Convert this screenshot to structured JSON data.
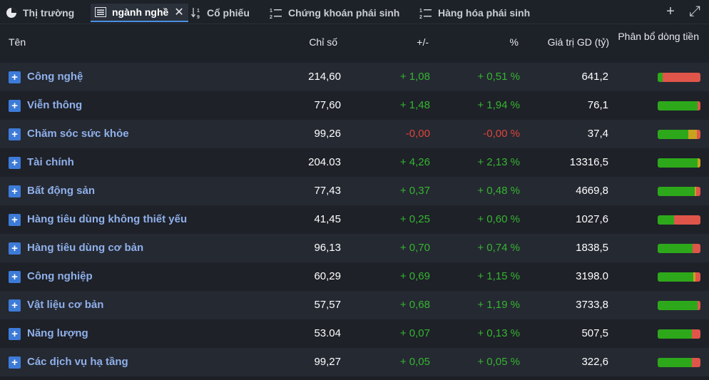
{
  "tabs": [
    {
      "label": "Thị trường",
      "icon": "pie-chart-icon"
    },
    {
      "label": "ngành nghề",
      "icon": "list-icon"
    },
    {
      "label": "Cổ phiếu",
      "icon": "sort-icon"
    },
    {
      "label": "Chứng khoán phái sinh",
      "icon": "numbered-list-icon"
    },
    {
      "label": "Hàng hóa phái sinh",
      "icon": "numbered-list-icon"
    }
  ],
  "actions": {
    "add": "+",
    "expand": "⤢"
  },
  "columns": {
    "name": "Tên",
    "index": "Chỉ số",
    "change": "+/-",
    "percent": "%",
    "value": "Giá trị GD (tỷ)",
    "flow": "Phân bổ dòng tiền"
  },
  "rows": [
    {
      "name": "Công nghệ",
      "index": "214,60",
      "change": "+ 1,08",
      "percent": "+ 0,51 %",
      "value": "641,2",
      "flow": [
        0.12,
        0.0,
        0.88
      ]
    },
    {
      "name": "Viễn thông",
      "index": "77,60",
      "change": "+ 1,48",
      "percent": "+ 1,94 %",
      "value": "76,1",
      "flow": [
        0.93,
        0.0,
        0.07
      ]
    },
    {
      "name": "Chăm sóc sức khỏe",
      "index": "99,26",
      "change": "-0,00",
      "percent": "-0,00 %",
      "value": "37,4",
      "flow": [
        0.72,
        0.2,
        0.08
      ]
    },
    {
      "name": "Tài chính",
      "index": "204.03",
      "change": "+ 4,26",
      "percent": "+ 2,13 %",
      "value": "13316,5",
      "flow": [
        0.94,
        0.06,
        0.0
      ]
    },
    {
      "name": "Bất động sản",
      "index": "77,43",
      "change": "+ 0,37",
      "percent": "+ 0,48 %",
      "value": "4669,8",
      "flow": [
        0.86,
        0.04,
        0.1
      ]
    },
    {
      "name": "Hàng tiêu dùng không thiết yếu",
      "index": "41,45",
      "change": "+ 0,25",
      "percent": "+ 0,60 %",
      "value": "1027,6",
      "flow": [
        0.38,
        0.0,
        0.62
      ]
    },
    {
      "name": "Hàng tiêu dùng cơ bản",
      "index": "96,13",
      "change": "+ 0,70",
      "percent": "+ 0,74 %",
      "value": "1838,5",
      "flow": [
        0.82,
        0.0,
        0.18
      ]
    },
    {
      "name": "Công nghiệp",
      "index": "60,29",
      "change": "+ 0,69",
      "percent": "+ 1,15 %",
      "value": "3198.0",
      "flow": [
        0.84,
        0.04,
        0.12
      ]
    },
    {
      "name": "Vật liệu cơ bản",
      "index": "57,57",
      "change": "+ 0,68",
      "percent": "+ 1,19 %",
      "value": "3733,8",
      "flow": [
        0.93,
        0.0,
        0.07
      ]
    },
    {
      "name": "Năng lượng",
      "index": "53.04",
      "change": "+ 0,07",
      "percent": "+ 0,13 %",
      "value": "507,5",
      "flow": [
        0.8,
        0.0,
        0.2
      ]
    },
    {
      "name": "Các dịch vụ hạ tầng",
      "index": "99,27",
      "change": "+ 0,05",
      "percent": "+ 0,05 %",
      "value": "322,6",
      "flow": [
        0.8,
        0.0,
        0.2
      ]
    }
  ],
  "colors": {
    "up": "#35b530",
    "down": "#e0443a",
    "flow_green": "#2ea81b",
    "flow_yellow": "#c9a21e",
    "flow_red": "#e0554a"
  }
}
